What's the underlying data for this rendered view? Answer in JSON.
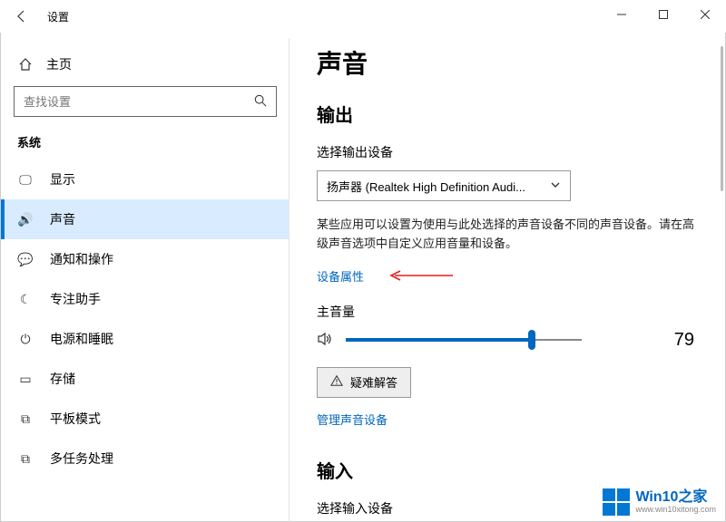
{
  "titlebar": {
    "app_title": "设置"
  },
  "sidebar": {
    "home_label": "主页",
    "search_placeholder": "查找设置",
    "category_title": "系统",
    "items": [
      {
        "icon": "display-icon",
        "glyph": "🖵",
        "label": "显示",
        "active": false
      },
      {
        "icon": "sound-icon",
        "glyph": "🔊",
        "label": "声音",
        "active": true
      },
      {
        "icon": "notifications-icon",
        "glyph": "💬",
        "label": "通知和操作",
        "active": false
      },
      {
        "icon": "focus-assist-icon",
        "glyph": "☾",
        "label": "专注助手",
        "active": false
      },
      {
        "icon": "power-sleep-icon",
        "glyph": "⏻",
        "label": "电源和睡眠",
        "active": false
      },
      {
        "icon": "storage-icon",
        "glyph": "▭",
        "label": "存储",
        "active": false
      },
      {
        "icon": "tablet-mode-icon",
        "glyph": "⧉",
        "label": "平板模式",
        "active": false
      },
      {
        "icon": "multitask-icon",
        "glyph": "⧉",
        "label": "多任务处理",
        "active": false
      }
    ]
  },
  "content": {
    "page_title": "声音",
    "output": {
      "section_title": "输出",
      "device_label": "选择输出设备",
      "device_selected": "扬声器 (Realtek High Definition Audi...",
      "description": "某些应用可以设置为使用与此处选择的声音设备不同的声音设备。请在高级声音选项中自定义应用音量和设备。",
      "device_properties_link": "设备属性",
      "master_volume_label": "主音量",
      "volume_value": "79",
      "volume_percent": 79,
      "troubleshoot_button": "疑难解答",
      "manage_devices_link": "管理声音设备"
    },
    "input": {
      "section_title": "输入",
      "device_label": "选择输入设备"
    }
  },
  "watermark": {
    "name": "Win10之家",
    "url": "www.win10xitong.com"
  }
}
